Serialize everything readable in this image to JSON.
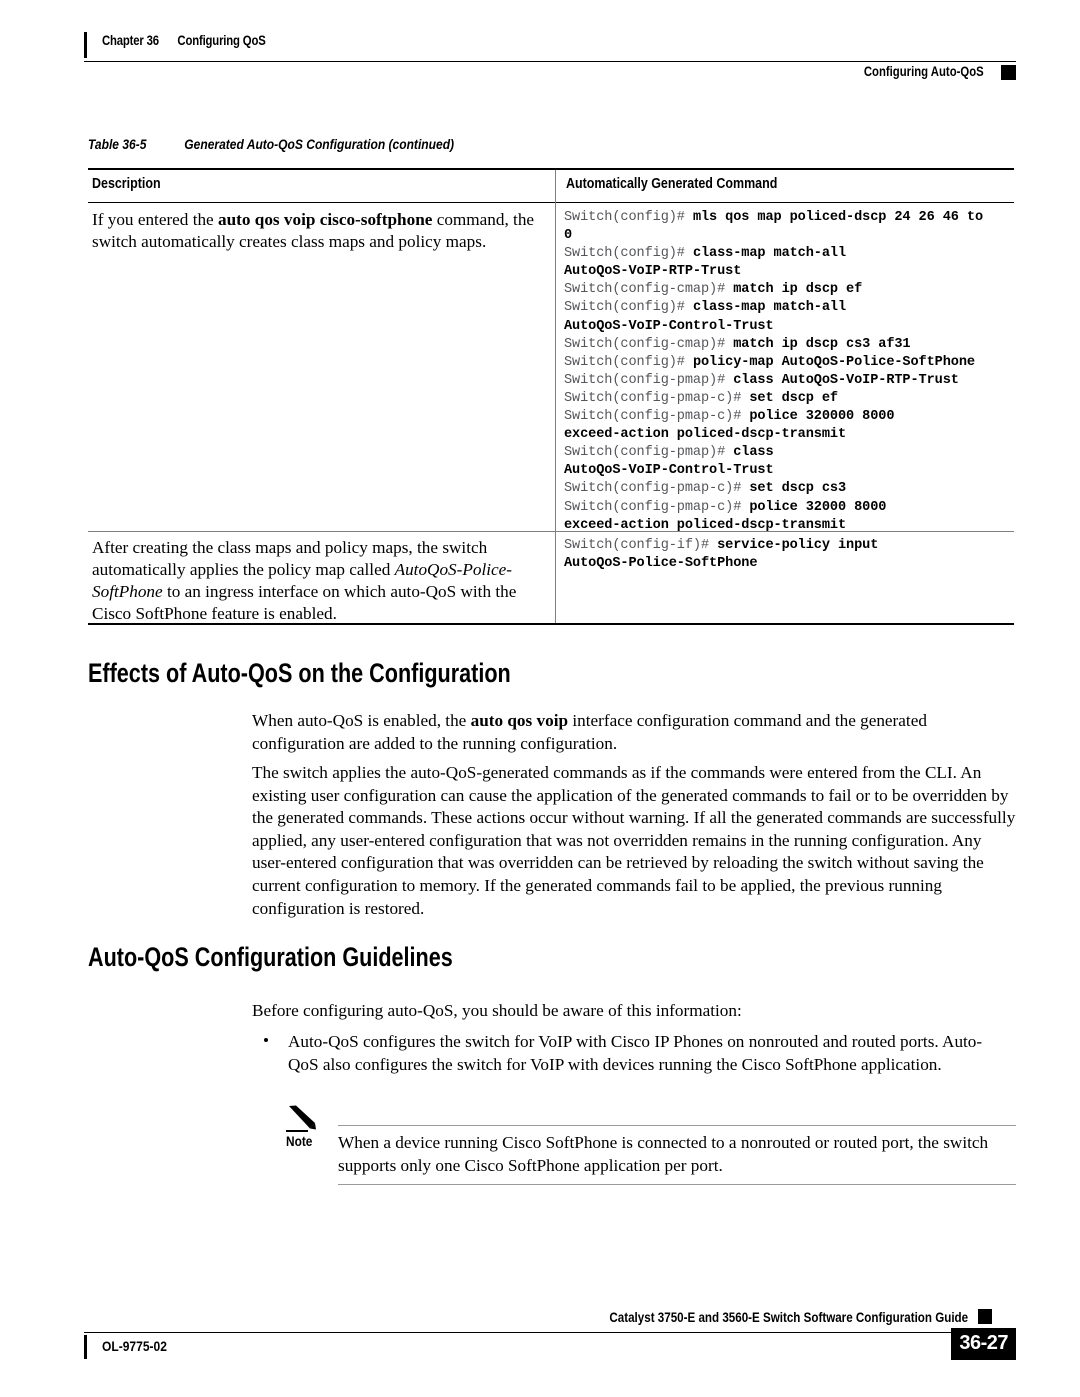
{
  "header": {
    "chapter": "Chapter 36",
    "chapter_title": "Configuring QoS",
    "section": "Configuring Auto-QoS"
  },
  "table": {
    "caption_label": "Table 36-5",
    "caption_title": "Generated Auto-QoS Configuration (continued)",
    "columns": [
      "Description",
      "Automatically Generated Command"
    ],
    "rows": [
      {
        "description_html": "If you entered the <b>auto qos voip cisco-softphone</b> command, the switch automatically creates class maps and policy maps.",
        "command_lines": [
          {
            "prompt": "Switch(config)#",
            "command": "mls qos map policed-dscp 24 26 46 to"
          },
          {
            "prompt": "",
            "command": "0"
          },
          {
            "prompt": "Switch(config)#",
            "command": "class-map match-all"
          },
          {
            "prompt": "",
            "command": "AutoQoS-VoIP-RTP-Trust"
          },
          {
            "prompt": "Switch(config-cmap)#",
            "command": "match ip dscp ef"
          },
          {
            "prompt": "Switch(config)#",
            "command": "class-map match-all"
          },
          {
            "prompt": "",
            "command": "AutoQoS-VoIP-Control-Trust"
          },
          {
            "prompt": "Switch(config-cmap)#",
            "command": "match ip dscp cs3 af31"
          },
          {
            "prompt": "Switch(config)#",
            "command": "policy-map AutoQoS-Police-SoftPhone"
          },
          {
            "prompt": "Switch(config-pmap)#",
            "command": "class AutoQoS-VoIP-RTP-Trust"
          },
          {
            "prompt": "Switch(config-pmap-c)#",
            "command": "set dscp ef"
          },
          {
            "prompt": "Switch(config-pmap-c)#",
            "command": "police 320000 8000"
          },
          {
            "prompt": "",
            "command": "exceed-action policed-dscp-transmit"
          },
          {
            "prompt": "Switch(config-pmap)#",
            "command": "class"
          },
          {
            "prompt": "",
            "command": "AutoQoS-VoIP-Control-Trust"
          },
          {
            "prompt": "Switch(config-pmap-c)#",
            "command": "set dscp cs3"
          },
          {
            "prompt": "Switch(config-pmap-c)#",
            "command": "police 32000 8000"
          },
          {
            "prompt": "",
            "command": "exceed-action policed-dscp-transmit"
          }
        ]
      },
      {
        "description_html": "After creating the class maps and policy maps, the switch automatically applies the policy map called <i>AutoQoS-Police-SoftPhone</i> to an ingress interface on which auto-QoS with the Cisco SoftPhone feature is enabled.",
        "command_lines": [
          {
            "prompt": "Switch(config-if)#",
            "command": "service-policy input"
          },
          {
            "prompt": "",
            "command": "AutoQoS-Police-SoftPhone"
          }
        ]
      }
    ]
  },
  "sections": [
    {
      "heading": "Effects of Auto-QoS on the Configuration",
      "paragraphs": [
        "When auto-QoS is enabled, the <b>auto qos voip</b> interface configuration command and the generated configuration are added to the running configuration.",
        "The switch applies the auto-QoS-generated commands as if the commands were entered from the CLI. An existing user configuration can cause the application of the generated commands to fail or to be overridden by the generated commands. These actions occur without warning. If all the generated commands are successfully applied, any user-entered configuration that was not overridden remains in the running configuration. Any user-entered configuration that was overridden can be retrieved by reloading the switch without saving the current configuration to memory. If the generated commands fail to be applied, the previous running configuration is restored."
      ]
    },
    {
      "heading": "Auto-QoS Configuration Guidelines",
      "intro": "Before configuring auto-QoS, you should be aware of this information:",
      "bullets": [
        "Auto-QoS configures the switch for VoIP with Cisco IP Phones on nonrouted and routed ports. Auto-QoS also configures the switch for VoIP with devices running the Cisco SoftPhone application."
      ]
    }
  ],
  "note": {
    "label": "Note",
    "text": "When a device running Cisco SoftPhone is connected to a nonrouted or routed port, the switch supports only one Cisco SoftPhone application per port."
  },
  "footer": {
    "doc_title": "Catalyst 3750-E and 3560-E Switch Software Configuration Guide",
    "doc_number": "OL-9775-02",
    "page_number": "36-27"
  },
  "colors": {
    "text": "#000000",
    "prompt": "#55565a",
    "rule": "#000000",
    "light_rule": "#9a9a9a"
  }
}
